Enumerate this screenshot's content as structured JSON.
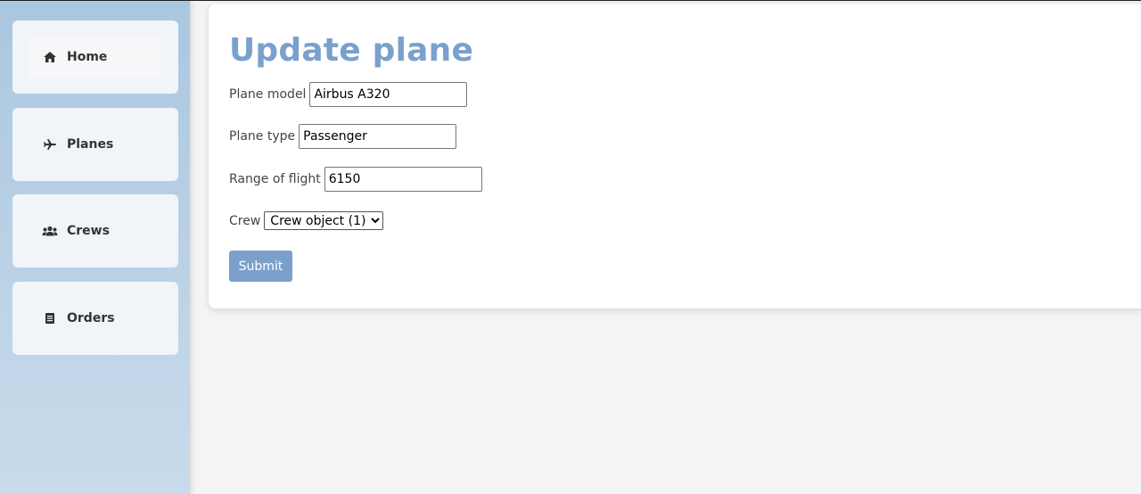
{
  "sidebar": {
    "items": [
      {
        "label": "Home",
        "icon": "home-icon"
      },
      {
        "label": "Planes",
        "icon": "plane-icon"
      },
      {
        "label": "Crews",
        "icon": "users-icon"
      },
      {
        "label": "Orders",
        "icon": "document-icon"
      }
    ]
  },
  "form": {
    "title": "Update plane",
    "plane_model_label": "Plane model",
    "plane_model_value": "Airbus A320",
    "plane_type_label": "Plane type",
    "plane_type_value": "Passenger",
    "range_label": "Range of flight",
    "range_value": "6150",
    "crew_label": "Crew",
    "crew_selected": "Crew object (1)",
    "submit_label": "Submit"
  },
  "colors": {
    "accent": "#7aa0cd",
    "sidebar": "#aac7e0",
    "background": "#f4f4f4"
  }
}
